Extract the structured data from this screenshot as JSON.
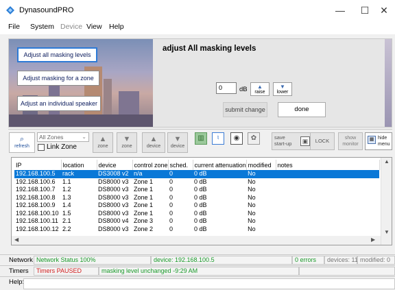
{
  "window": {
    "title": "DynasoundPRO",
    "controls": {
      "minimize": "—",
      "maximize": "☐",
      "close": "✕"
    }
  },
  "menu": {
    "file": "File",
    "system": "System",
    "device": "Device",
    "view": "View",
    "help": "Help"
  },
  "panel": {
    "mode_buttons": {
      "all": "Adjust all masking levels",
      "zone": "Adjust masking for a zone",
      "speaker": "Adjust an individual speaker"
    },
    "title": "adjust All masking levels",
    "db_value": "0",
    "db_unit": "dB",
    "raise": "raise",
    "lower": "lower",
    "submit": "submit change",
    "done": "done"
  },
  "toolbar": {
    "refresh": "refresh",
    "zone_select": "All Zones",
    "link_zone": "Link Zone",
    "zone_a": "zone",
    "zone_b": "zone",
    "device_a": "device",
    "device_b": "device",
    "save_startup": "save start-up",
    "lock": "LOCK",
    "show_monitor": "show monitor",
    "hide_menu": "hide menu"
  },
  "table": {
    "headers": [
      "IP",
      "location",
      "device",
      "control zone",
      "sched.",
      "current attenuation",
      "modified",
      "notes"
    ],
    "rows": [
      [
        "192.168.100.5",
        "rack",
        "DS3008 v2",
        "n/a",
        "0",
        "0 dB",
        "No",
        ""
      ],
      [
        "192.168.100.6",
        "1.1",
        "DS8000 v3",
        "Zone 1",
        "0",
        "0 dB",
        "No",
        ""
      ],
      [
        "192.168.100.7",
        "1.2",
        "DS8000 v3",
        "Zone 1",
        "0",
        "0 dB",
        "No",
        ""
      ],
      [
        "192.168.100.8",
        "1.3",
        "DS8000 v3",
        "Zone 1",
        "0",
        "0 dB",
        "No",
        ""
      ],
      [
        "192.168.100.9",
        "1.4",
        "DS8000 v3",
        "Zone 1",
        "0",
        "0 dB",
        "No",
        ""
      ],
      [
        "192.168.100.10",
        "1.5",
        "DS8000 v3",
        "Zone 1",
        "0",
        "0 dB",
        "No",
        ""
      ],
      [
        "192.168.100.11",
        "2.1",
        "DS8000 v4",
        "Zone 3",
        "0",
        "0 dB",
        "No",
        ""
      ],
      [
        "192.168.100.12",
        "2.2",
        "DS8000 v3",
        "Zone 2",
        "0",
        "0 dB",
        "No",
        ""
      ]
    ],
    "selected_row": 0
  },
  "status": {
    "network_label": "Network",
    "network_status": "Network Status 100%",
    "device": "device: 192.168.100.5",
    "errors": "0 errors",
    "devices": "devices: 11",
    "modified": "modified: 0",
    "timers_label": "Timers",
    "timers_status": "Timers PAUSED",
    "masking": "masking level unchanged -9:29 AM",
    "help_label": "Help:"
  },
  "colors": {
    "selection": "#0a78d7",
    "accent": "#2d7ad6",
    "ok_green": "#1a9a2a",
    "alert_red": "#d21e1e"
  }
}
